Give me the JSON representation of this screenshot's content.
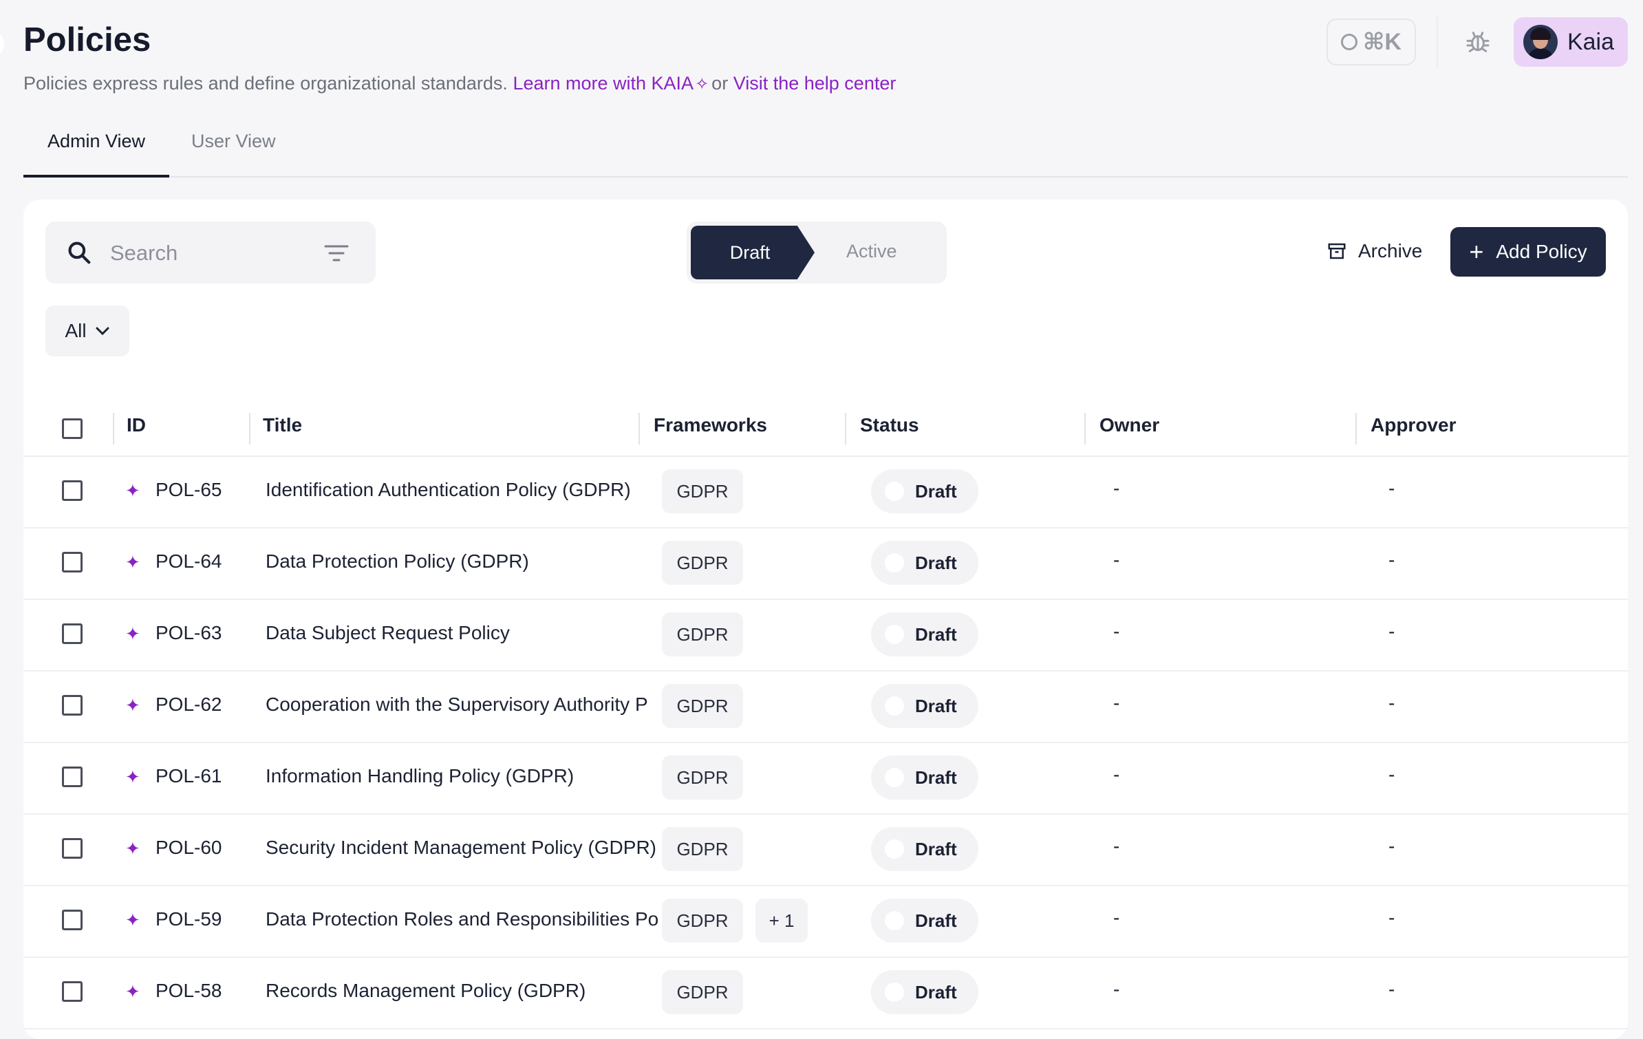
{
  "header": {
    "title": "Policies",
    "subtitle_text": "Policies express rules and define organizational standards.",
    "learn_link": "Learn more with KAIA",
    "or_text": "or",
    "help_link": "Visit the help center",
    "shortcut_label": "⌘K",
    "user_name": "Kaia"
  },
  "tabs": [
    {
      "label": "Admin View",
      "active": true
    },
    {
      "label": "User View",
      "active": false
    }
  ],
  "toolbar": {
    "search_placeholder": "Search",
    "segment": {
      "draft": "Draft",
      "active": "Active"
    },
    "archive_label": "Archive",
    "add_policy_label": "Add Policy",
    "filter_value": "All"
  },
  "table": {
    "columns": {
      "id": "ID",
      "title": "Title",
      "frameworks": "Frameworks",
      "status": "Status",
      "owner": "Owner",
      "approver": "Approver"
    },
    "rows": [
      {
        "id": "POL-65",
        "title": "Identification Authentication Policy (GDPR)",
        "framework": "GDPR",
        "extra": "",
        "status": "Draft",
        "owner": "-",
        "approver": "-"
      },
      {
        "id": "POL-64",
        "title": "Data Protection Policy (GDPR)",
        "framework": "GDPR",
        "extra": "",
        "status": "Draft",
        "owner": "-",
        "approver": "-"
      },
      {
        "id": "POL-63",
        "title": "Data Subject Request Policy",
        "framework": "GDPR",
        "extra": "",
        "status": "Draft",
        "owner": "-",
        "approver": "-"
      },
      {
        "id": "POL-62",
        "title": "Cooperation with the Supervisory Authority P",
        "framework": "GDPR",
        "extra": "",
        "status": "Draft",
        "owner": "-",
        "approver": "-"
      },
      {
        "id": "POL-61",
        "title": "Information Handling Policy (GDPR)",
        "framework": "GDPR",
        "extra": "",
        "status": "Draft",
        "owner": "-",
        "approver": "-"
      },
      {
        "id": "POL-60",
        "title": "Security Incident Management Policy (GDPR)",
        "framework": "GDPR",
        "extra": "",
        "status": "Draft",
        "owner": "-",
        "approver": "-"
      },
      {
        "id": "POL-59",
        "title": "Data Protection Roles and Responsibilities Po",
        "framework": "GDPR",
        "extra": "+ 1",
        "status": "Draft",
        "owner": "-",
        "approver": "-"
      },
      {
        "id": "POL-58",
        "title": "Records Management Policy (GDPR)",
        "framework": "GDPR",
        "extra": "",
        "status": "Draft",
        "owner": "-",
        "approver": "-"
      }
    ]
  },
  "colors": {
    "accent_purple": "#8a22c4",
    "primary_dark": "#1f2840",
    "user_chip": "#ead3f7"
  },
  "icons": {
    "shortcut": "compass-icon",
    "debug": "bug-icon",
    "search": "search-icon",
    "filter": "filter-icon",
    "archive": "archive-icon",
    "add": "plus-icon",
    "dropdown": "chevron-down-icon",
    "ai_marker": "sparkle-icon"
  }
}
